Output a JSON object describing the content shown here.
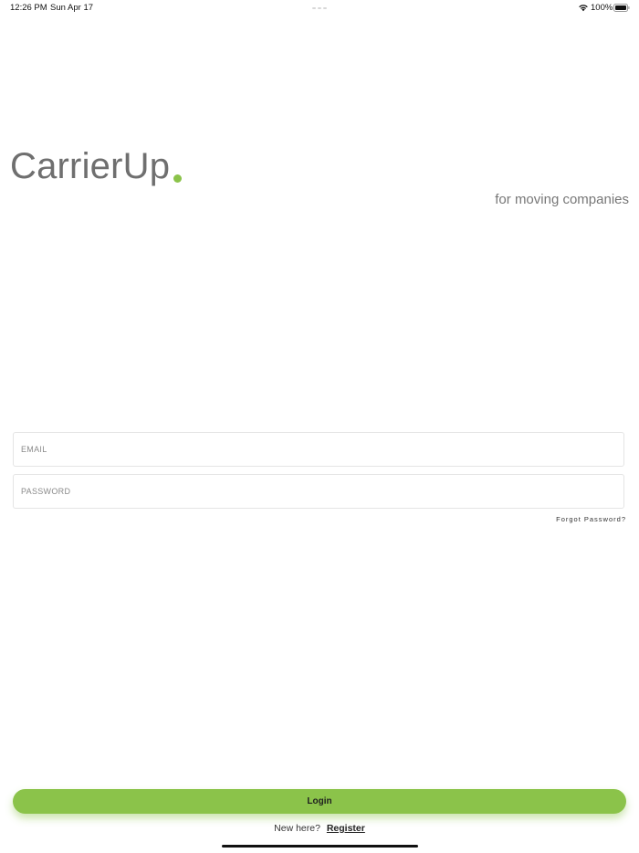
{
  "status_bar": {
    "time": "12:26 PM",
    "date": "Sun Apr 17",
    "battery": "100%"
  },
  "brand": {
    "name": "CarrierUp",
    "tagline": "for moving companies",
    "accent_color": "#8bc34a"
  },
  "form": {
    "email_placeholder": "EMAIL",
    "email_value": "",
    "password_placeholder": "PASSWORD",
    "password_value": "",
    "forgot_label": "Forgot Password?"
  },
  "actions": {
    "login_label": "Login",
    "new_here_label": "New here?",
    "register_label": "Register"
  },
  "icons": {
    "wifi": "wifi-icon",
    "battery": "battery-icon"
  }
}
